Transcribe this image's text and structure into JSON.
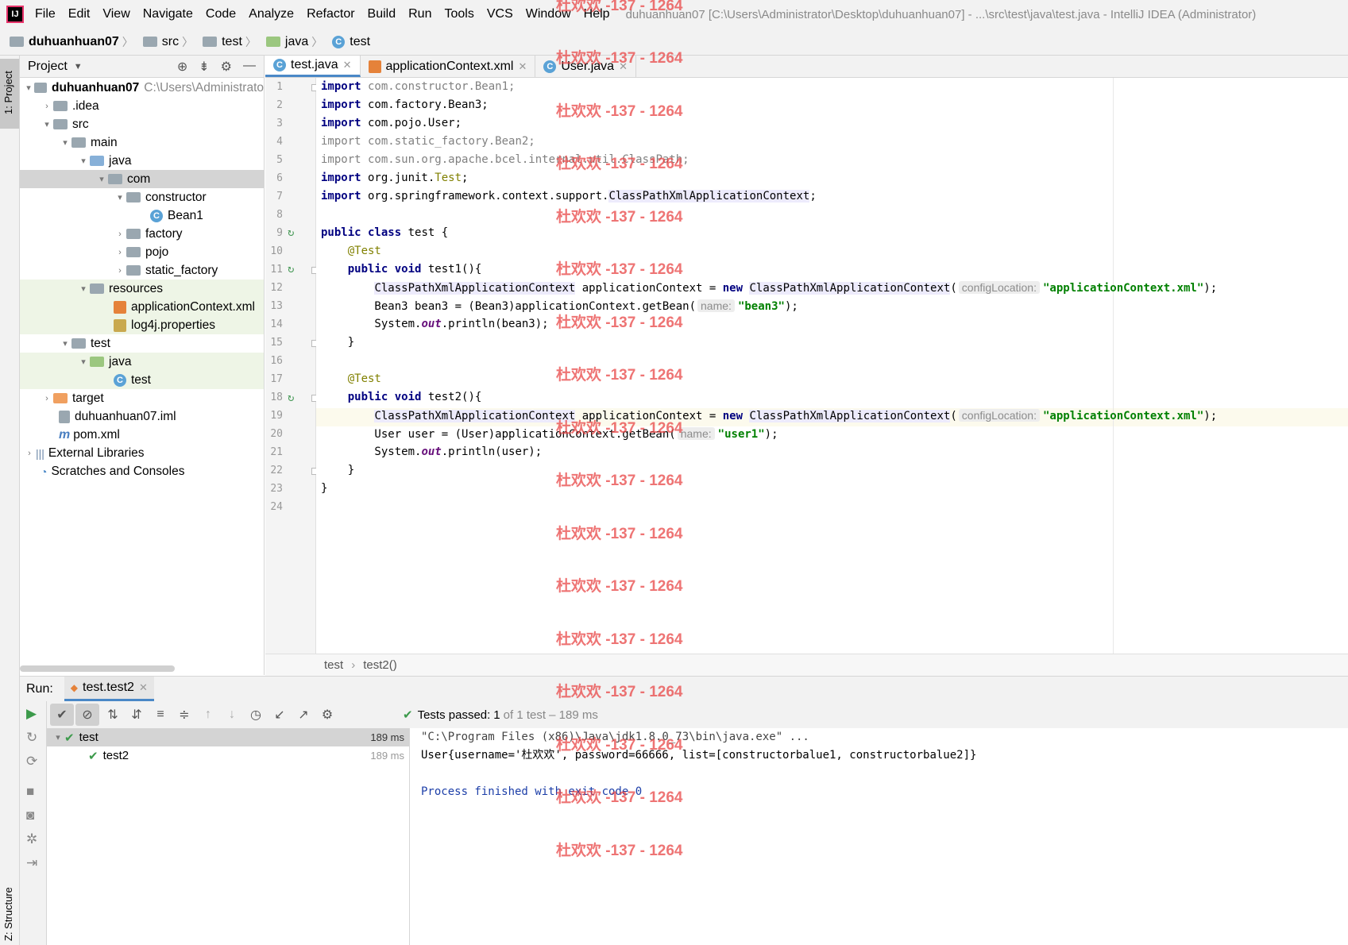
{
  "menubar": {
    "items": [
      "File",
      "Edit",
      "View",
      "Navigate",
      "Code",
      "Analyze",
      "Refactor",
      "Build",
      "Run",
      "Tools",
      "VCS",
      "Window",
      "Help"
    ],
    "window_title": "duhuanhuan07 [C:\\Users\\Administrator\\Desktop\\duhuanhuan07] - ...\\src\\test\\java\\test.java - IntelliJ IDEA (Administrator)"
  },
  "breadcrumb": [
    "duhuanhuan07",
    "src",
    "test",
    "java",
    "test"
  ],
  "left_strip": {
    "project_label": "1: Project",
    "structure_label": "Z: Structure"
  },
  "project": {
    "header": "Project",
    "tree": [
      {
        "label": "duhuanhuan07",
        "extra": "C:\\Users\\Administrato"
      },
      {
        "label": ".idea"
      },
      {
        "label": "src"
      },
      {
        "label": "main"
      },
      {
        "label": "java"
      },
      {
        "label": "com"
      },
      {
        "label": "constructor"
      },
      {
        "label": "Bean1"
      },
      {
        "label": "factory"
      },
      {
        "label": "pojo"
      },
      {
        "label": "static_factory"
      },
      {
        "label": "resources"
      },
      {
        "label": "applicationContext.xml"
      },
      {
        "label": "log4j.properties"
      },
      {
        "label": "test"
      },
      {
        "label": "java"
      },
      {
        "label": "test"
      },
      {
        "label": "target"
      },
      {
        "label": "duhuanhuan07.iml"
      },
      {
        "label": "pom.xml"
      },
      {
        "label": "External Libraries"
      },
      {
        "label": "Scratches and Consoles"
      }
    ]
  },
  "editor": {
    "tabs": [
      "test.java",
      "applicationContext.xml",
      "User.java"
    ],
    "line_numbers": [
      "1",
      "2",
      "3",
      "4",
      "5",
      "6",
      "7",
      "8",
      "9",
      "10",
      "11",
      "12",
      "13",
      "14",
      "15",
      "16",
      "17",
      "18",
      "19",
      "20",
      "21",
      "22",
      "23",
      "24"
    ],
    "code": {
      "l1": [
        "import",
        " com.constructor.Bean1;"
      ],
      "l2": [
        "import",
        " com.factory.Bean3;"
      ],
      "l3": [
        "import",
        " com.pojo.User;"
      ],
      "l4": [
        "import",
        " com.static_factory.Bean2;"
      ],
      "l5": [
        "import",
        " com.sun.org.apache.bcel.internal.util.ClassPath;"
      ],
      "l6": [
        "import",
        " org.junit.",
        "Test",
        ";"
      ],
      "l7": [
        "import",
        " org.springframework.context.support.",
        "ClassPathXmlApplicationContext",
        ";"
      ],
      "l9": [
        "public class",
        " test {"
      ],
      "l10": [
        "    ",
        "@Test"
      ],
      "l11": [
        "    ",
        "public void",
        " test1(){"
      ],
      "l12": [
        "        ",
        "ClassPathXmlApplicationContext",
        " applicationContext = ",
        "new",
        " ",
        "ClassPathXmlApplicationContext",
        "(",
        "configLocation:",
        "\"applicationContext.xml\"",
        ");"
      ],
      "l13": [
        "        Bean3 bean3 = (Bean3)applicationContext.getBean(",
        "name:",
        "\"bean3\"",
        ");"
      ],
      "l14": [
        "        System.",
        "out",
        ".println(bean3);"
      ],
      "l15": [
        "    }"
      ],
      "l17": [
        "    ",
        "@Test"
      ],
      "l18": [
        "    ",
        "public void",
        " test2(){"
      ],
      "l19": [
        "        ",
        "ClassPathXmlApplicationContext",
        " applicationContext = ",
        "new",
        " ",
        "ClassPathXmlApplicationContext",
        "(",
        "configLocation:",
        "\"applicationContext.xml\"",
        ");"
      ],
      "l20": [
        "        User user = (User)applicationContext.getBean(",
        "name:",
        "\"user1\"",
        ");"
      ],
      "l21": [
        "        System.",
        "out",
        ".println(user);"
      ],
      "l22": [
        "    }"
      ],
      "l23": [
        "}"
      ]
    },
    "breadcrumb": [
      "test",
      "test2()"
    ]
  },
  "run": {
    "label": "Run:",
    "tab": "test.test2",
    "status_prefix": "Tests passed:",
    "status_count": "1",
    "status_suffix": "of 1 test – 189 ms",
    "tree": [
      {
        "label": "test",
        "time": "189 ms"
      },
      {
        "label": "test2",
        "time": "189 ms"
      }
    ],
    "console": [
      "\"C:\\Program Files (x86)\\Java\\jdk1.8.0_73\\bin\\java.exe\" ...",
      "User{username='杜欢欢', password=66666, list=[constructorbalue1, constructorbalue2]}",
      "",
      "Process finished with exit code 0"
    ]
  },
  "watermark": "杜欢欢 -137 - 1264"
}
